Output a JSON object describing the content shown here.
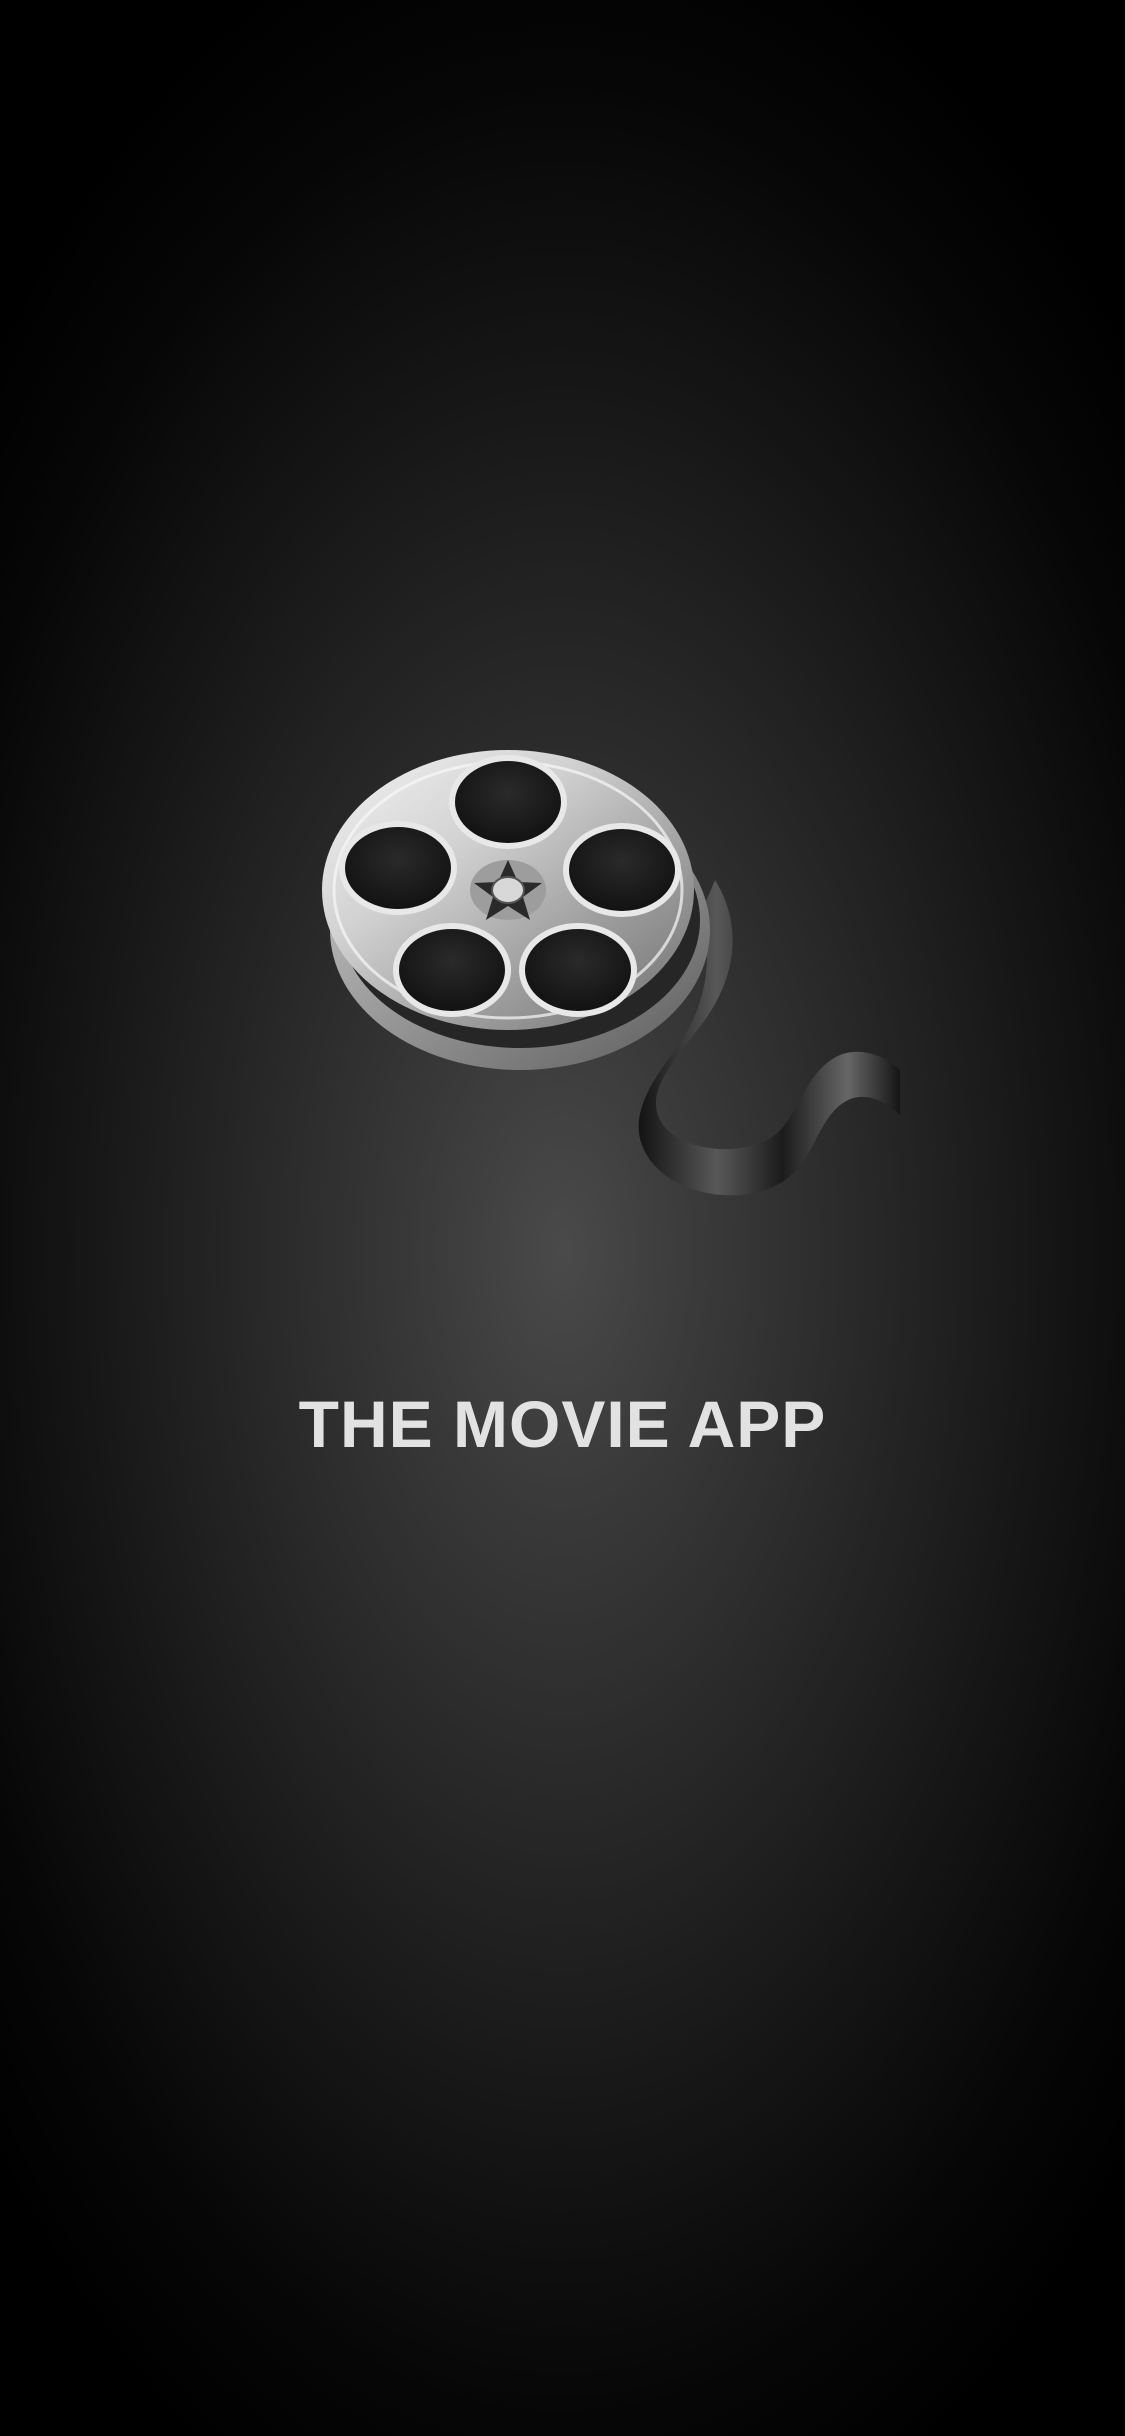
{
  "app": {
    "title": "THE MOVIE APP",
    "logo_icon": "film-reel-icon"
  },
  "colors": {
    "background_center": "#4a4a4a",
    "background_edge": "#000000",
    "title_text": "#e2e2e2",
    "reel_metal": "#c8c8c8"
  }
}
